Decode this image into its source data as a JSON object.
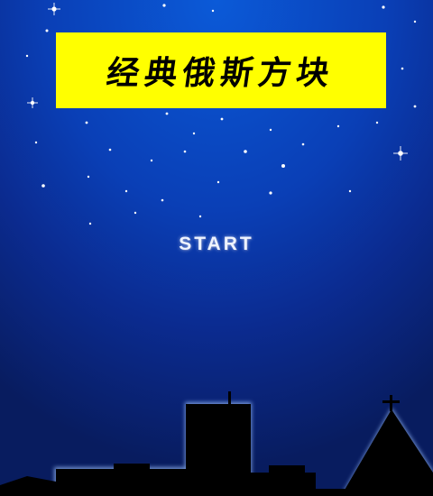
{
  "title": {
    "text": "经典俄斯方块"
  },
  "menu": {
    "start_label": "START"
  },
  "colors": {
    "title_bg": "#ffff00",
    "sky": "#0a3fb6",
    "silhouette": "#000000"
  }
}
